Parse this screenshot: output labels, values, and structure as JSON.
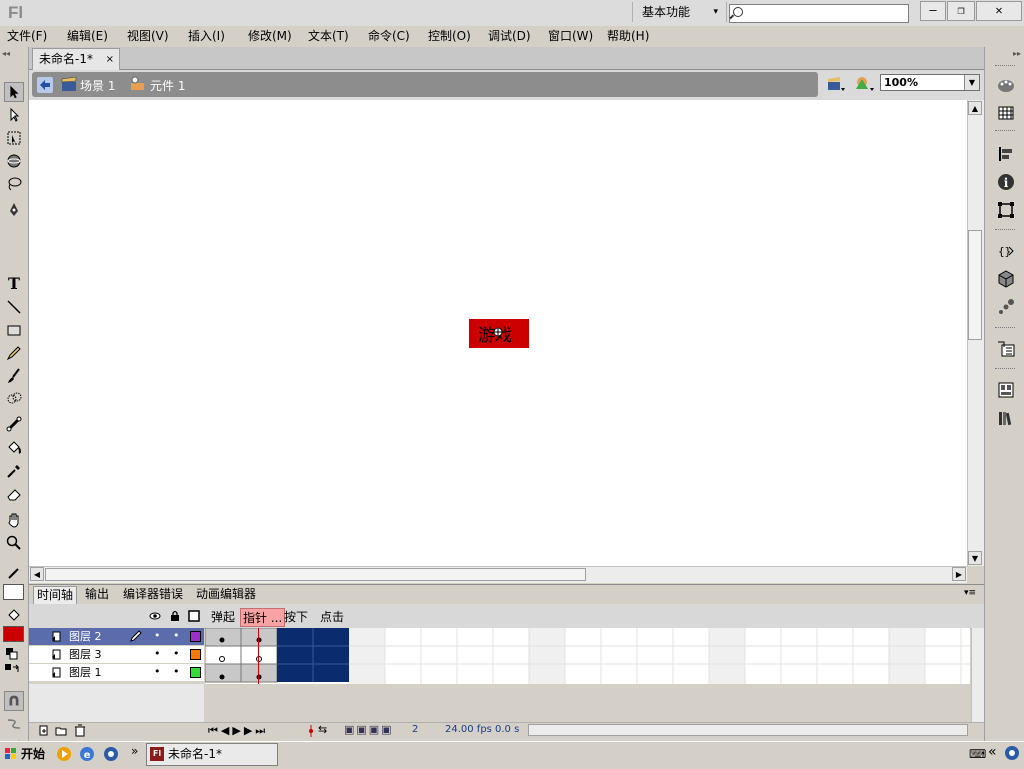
{
  "window": {
    "app_logo": "Fl",
    "workspace": "基本功能",
    "search_placeholder": "",
    "controls": {
      "minimize": "—",
      "restore": "❐",
      "close": "✕"
    }
  },
  "menu": [
    "文件(F)",
    "编辑(E)",
    "视图(V)",
    "插入(I)",
    "修改(M)",
    "文本(T)",
    "命令(C)",
    "控制(O)",
    "调试(D)",
    "窗口(W)",
    "帮助(H)"
  ],
  "document_tab": {
    "title": "未命名-1*",
    "close": "×"
  },
  "editbar": {
    "breadcrumbs": [
      "场景 1",
      "元件 1"
    ],
    "zoom": "100%"
  },
  "stage": {
    "button_text": "游戏",
    "button_color": "#cc0000"
  },
  "panel_tabs": [
    "时间轴",
    "输出",
    "编译器错误",
    "动画编辑器"
  ],
  "timeline": {
    "states": [
      "弹起",
      "指针 ...",
      "按下",
      "点击"
    ],
    "layers": [
      {
        "name": "图层 2",
        "color": "#9b30c8",
        "selected": true
      },
      {
        "name": "图层 3",
        "color": "#ff7700",
        "selected": false
      },
      {
        "name": "图层 1",
        "color": "#33dd33",
        "selected": false
      }
    ],
    "status": {
      "frame": "2",
      "fps": "24.00 fps",
      "time": "0.0 s"
    }
  },
  "colors": {
    "stroke": "#000000",
    "fill": "#cc0000",
    "frame_fill": "#0a2b6e"
  },
  "taskbar": {
    "start": "开始",
    "task": "未命名-1*",
    "chevron": "»"
  }
}
